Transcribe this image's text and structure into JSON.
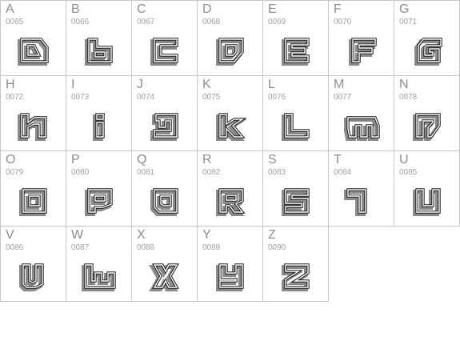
{
  "glyphs": [
    {
      "letter": "A",
      "code": "0065",
      "shape": "a"
    },
    {
      "letter": "B",
      "code": "0066",
      "shape": "b"
    },
    {
      "letter": "C",
      "code": "0067",
      "shape": "c"
    },
    {
      "letter": "D",
      "code": "0068",
      "shape": "d"
    },
    {
      "letter": "E",
      "code": "0069",
      "shape": "e"
    },
    {
      "letter": "F",
      "code": "0070",
      "shape": "f"
    },
    {
      "letter": "G",
      "code": "0071",
      "shape": "g"
    },
    {
      "letter": "H",
      "code": "0072",
      "shape": "h"
    },
    {
      "letter": "I",
      "code": "0073",
      "shape": "i"
    },
    {
      "letter": "J",
      "code": "0074",
      "shape": "j"
    },
    {
      "letter": "K",
      "code": "0075",
      "shape": "k"
    },
    {
      "letter": "L",
      "code": "0076",
      "shape": "l"
    },
    {
      "letter": "M",
      "code": "0077",
      "shape": "m"
    },
    {
      "letter": "N",
      "code": "0078",
      "shape": "n"
    },
    {
      "letter": "O",
      "code": "0079",
      "shape": "o"
    },
    {
      "letter": "P",
      "code": "0080",
      "shape": "p"
    },
    {
      "letter": "Q",
      "code": "0081",
      "shape": "q"
    },
    {
      "letter": "R",
      "code": "0082",
      "shape": "r"
    },
    {
      "letter": "S",
      "code": "0083",
      "shape": "s"
    },
    {
      "letter": "T",
      "code": "0084",
      "shape": "t"
    },
    {
      "letter": "U",
      "code": "0085",
      "shape": "u"
    },
    {
      "letter": "V",
      "code": "0086",
      "shape": "v"
    },
    {
      "letter": "W",
      "code": "0087",
      "shape": "w"
    },
    {
      "letter": "X",
      "code": "0088",
      "shape": "x"
    },
    {
      "letter": "Y",
      "code": "0089",
      "shape": "y"
    },
    {
      "letter": "Z",
      "code": "0090",
      "shape": "z"
    }
  ]
}
